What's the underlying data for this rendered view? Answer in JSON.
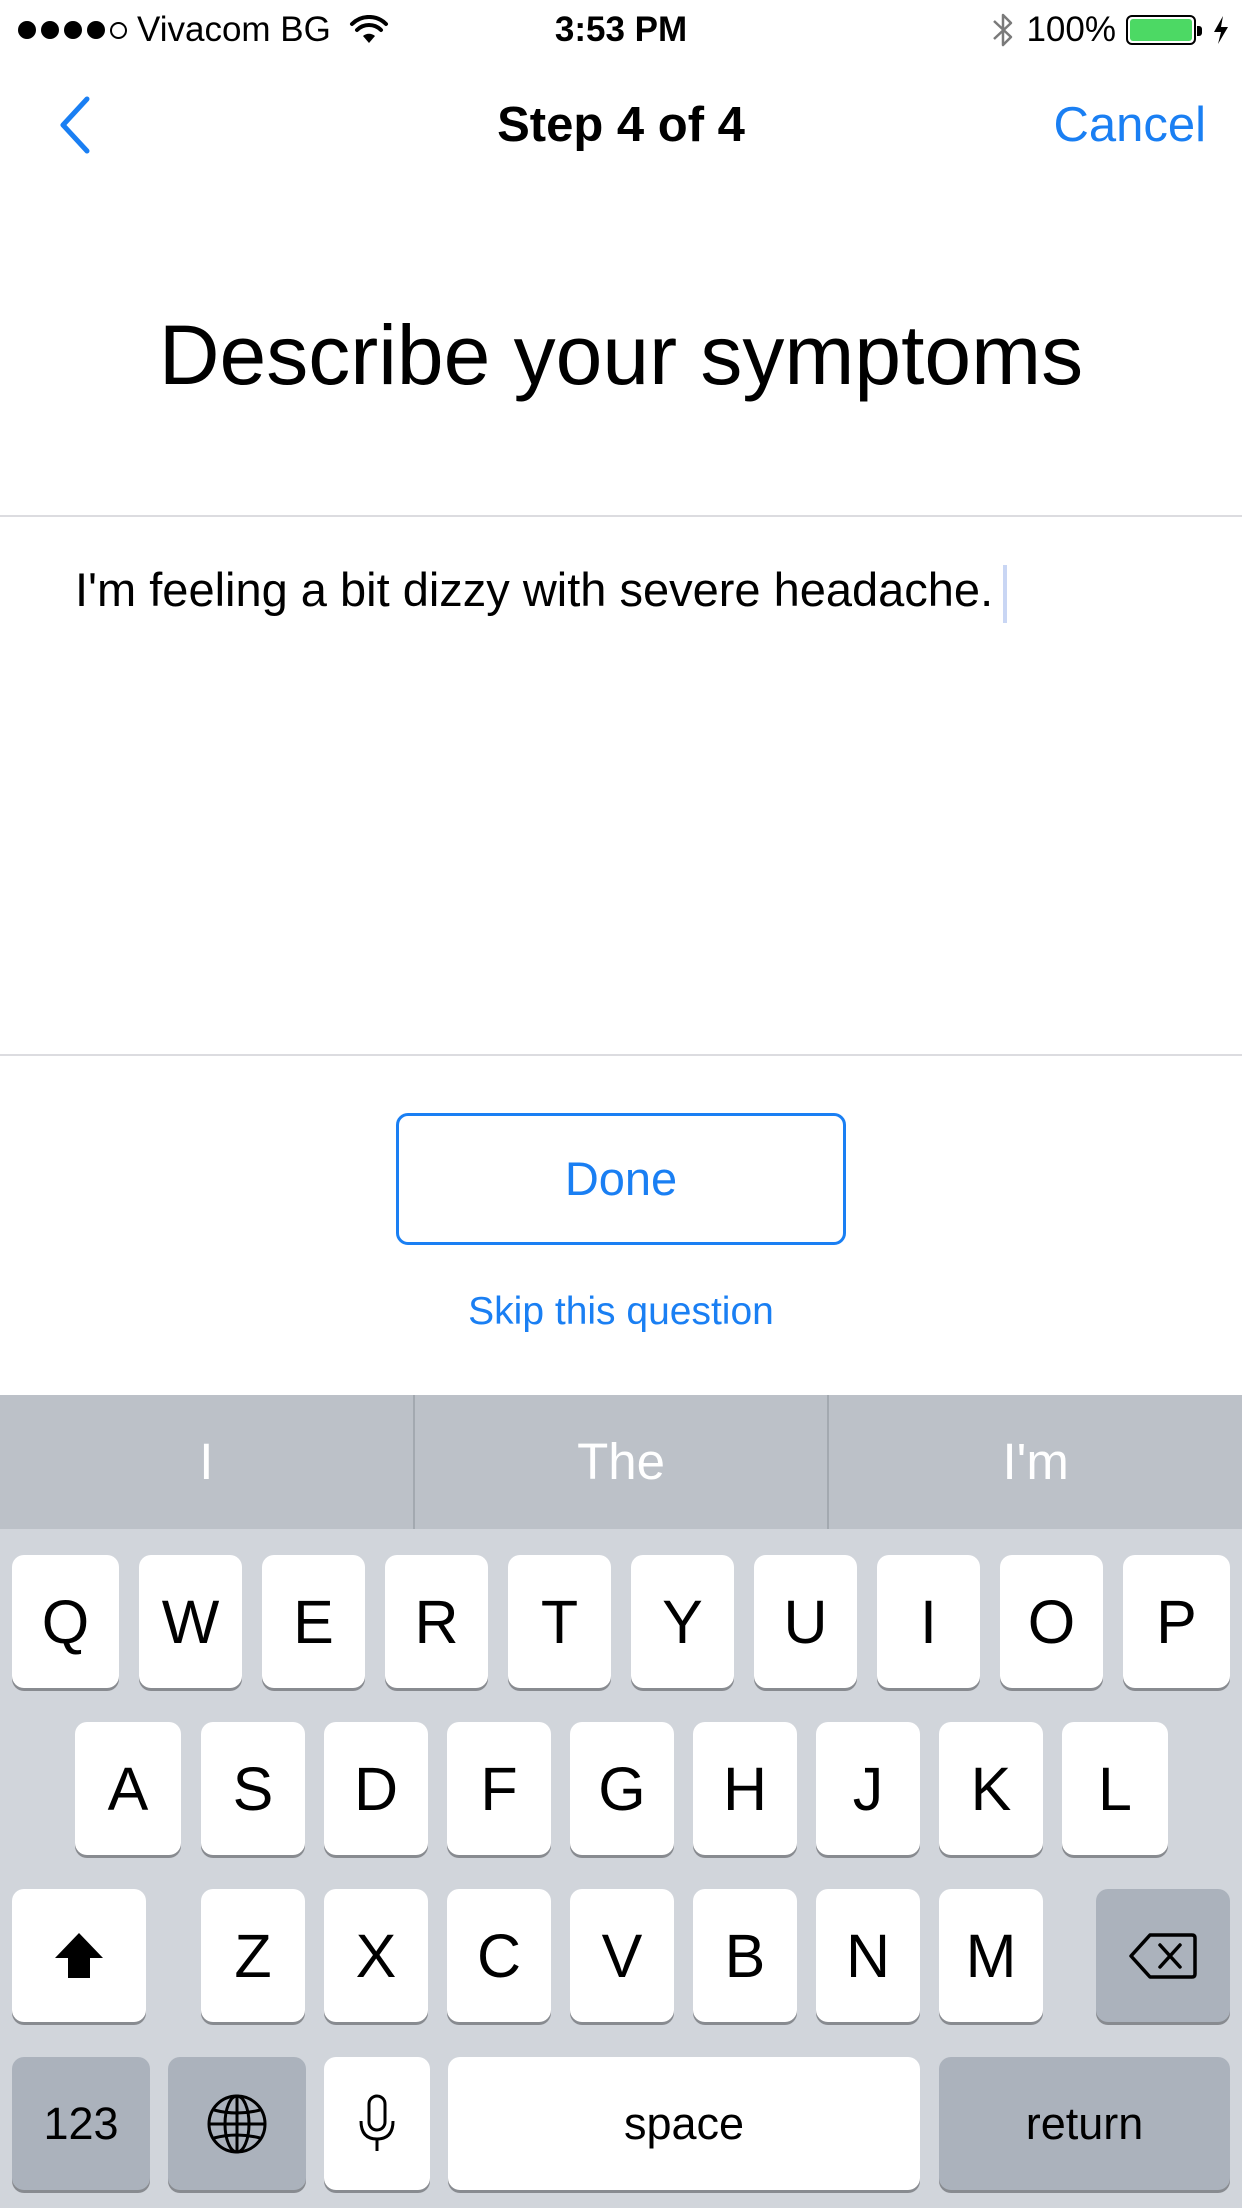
{
  "status_bar": {
    "carrier": "Vivacom BG",
    "time": "3:53 PM",
    "battery": "100%",
    "battery_level": 1.0,
    "signal_bars_filled": 4,
    "signal_bars_total": 5,
    "battery_color": "#4cd964"
  },
  "nav": {
    "title": "Step 4 of 4",
    "cancel_label": "Cancel",
    "back_icon": "chevron-left-icon"
  },
  "question": {
    "title": "Describe your symptoms",
    "answer": "I'm feeling a bit dizzy with severe headache."
  },
  "actions": {
    "done_label": "Done",
    "skip_label": "Skip this question"
  },
  "keyboard": {
    "predictions": [
      "I",
      "The",
      "I'm"
    ],
    "row1": [
      "Q",
      "W",
      "E",
      "R",
      "T",
      "Y",
      "U",
      "I",
      "O",
      "P"
    ],
    "row2": [
      "A",
      "S",
      "D",
      "F",
      "G",
      "H",
      "J",
      "K",
      "L"
    ],
    "row3": [
      "Z",
      "X",
      "C",
      "V",
      "B",
      "N",
      "M"
    ],
    "numbers_label": "123",
    "space_label": "space",
    "return_label": "return"
  },
  "colors": {
    "accent": "#1a7ff3",
    "keyboard_bg": "#d1d5db",
    "prediction_bar": "#bcc1c8",
    "dark_key": "#abb2bc"
  }
}
